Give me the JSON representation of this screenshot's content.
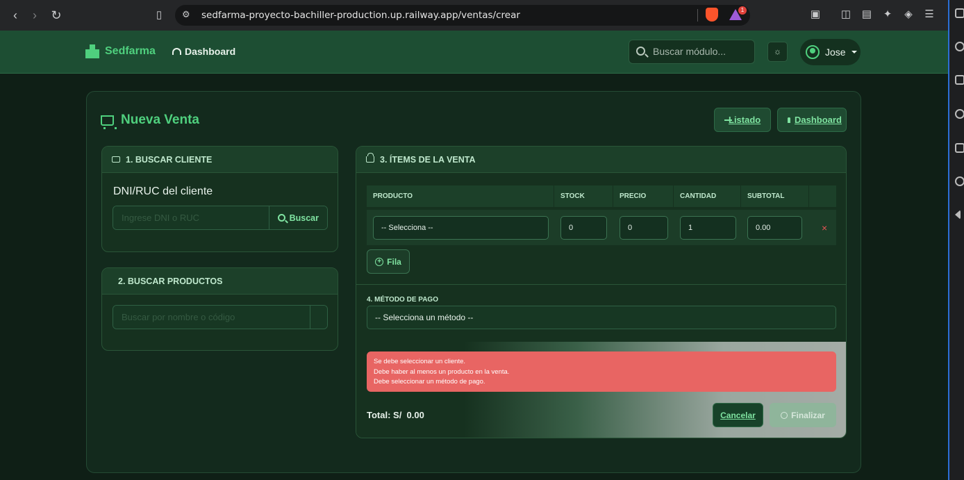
{
  "browser": {
    "url": "sedfarma-proyecto-bachiller-production.up.railway.app/ventas/crear",
    "notification_count": "1"
  },
  "header": {
    "brand": "Sedfarma",
    "nav_dashboard": "Dashboard",
    "search_placeholder": "Buscar módulo...",
    "user_name": "Jose"
  },
  "page": {
    "title": "Nueva Venta",
    "btn_listado": "Listado",
    "btn_dashboard": "Dashboard"
  },
  "cliente": {
    "section_title": "1. BUSCAR CLIENTE",
    "field_label": "DNI/RUC del cliente",
    "input_placeholder": "Ingrese DNI o RUC",
    "search_button": "Buscar"
  },
  "productos": {
    "section_title": "2. BUSCAR PRODUCTOS",
    "input_placeholder": "Buscar por nombre o código"
  },
  "items": {
    "section_title": "3. ÍTEMS DE LA VENTA",
    "columns": [
      "PRODUCTO",
      "STOCK",
      "PRECIO",
      "CANTIDAD",
      "SUBTOTAL"
    ],
    "row": {
      "producto": "-- Selecciona --",
      "stock": "0",
      "precio": "0",
      "cantidad": "1",
      "subtotal": "0.00",
      "remove": "×"
    },
    "add_row_button": "Fila"
  },
  "pago": {
    "section_title": "4. MÉTODO DE PAGO",
    "selected": "-- Selecciona un método --"
  },
  "errors": [
    "Se debe seleccionar un cliente.",
    "Debe haber al menos un producto en la venta.",
    "Debe seleccionar un método de pago."
  ],
  "footer": {
    "total_label": "Total: S/",
    "total_value": "0.00",
    "cancel_button": "Cancelar",
    "finalize_button": "Finalizar"
  },
  "colors": {
    "brand_green": "#4fd07e",
    "header_bg": "#1d4e33",
    "page_bg": "#0f1f16",
    "alert_red": "#e86563"
  }
}
